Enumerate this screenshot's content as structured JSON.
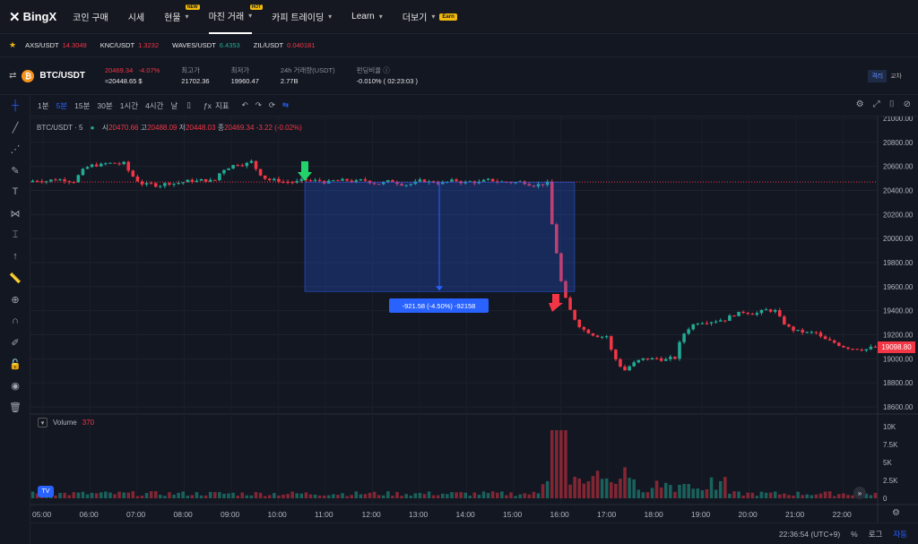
{
  "nav": {
    "brand": "BingX",
    "items": [
      {
        "label": "코인 구매"
      },
      {
        "label": "시세"
      },
      {
        "label": "현물",
        "badge": "NEW",
        "chevron": true
      },
      {
        "label": "마진 거래",
        "badge": "HOT",
        "chevron": true,
        "active": true
      },
      {
        "label": "카피 트레이딩",
        "chevron": true
      },
      {
        "label": "Learn",
        "chevron": true
      },
      {
        "label": "더보기",
        "chevron": true,
        "earn": "Earn"
      }
    ]
  },
  "ticker": [
    {
      "pair": "AXS/USDT",
      "price": "14.3049",
      "dir": "down"
    },
    {
      "pair": "KNC/USDT",
      "price": "1.3232",
      "dir": "down"
    },
    {
      "pair": "WAVES/USDT",
      "price": "6.4353",
      "dir": "up"
    },
    {
      "pair": "ZIL/USDT",
      "price": "0.040181",
      "dir": "down"
    }
  ],
  "pair": {
    "symbol": "BTC/USDT",
    "last_price": "20469.34",
    "change": "-4.07%",
    "usd": "≈20448.65 $",
    "high_label": "최고가",
    "high": "21702.36",
    "low_label": "최저가",
    "low": "19960.47",
    "vol_label": "24h 거래량(USDT)",
    "vol": "2.77B",
    "funding_label": "펀딩비율 ⓘ",
    "funding": "-0.010%  ( 02:23:03 )",
    "mode_a": "격리",
    "mode_b": "교차"
  },
  "toolbar": {
    "intervals": [
      "1분",
      "5분",
      "15분",
      "30분",
      "1시간",
      "4시간",
      "날"
    ],
    "active_interval": "5분",
    "indicators": "지표"
  },
  "legend": {
    "symbol": "BTC/USDT · 5",
    "open_label": "시",
    "open": "20470.66",
    "high_label": "고",
    "high": "20488.09",
    "low_label": "저",
    "low": "20448.03",
    "close_label": "종",
    "close": "20469.34",
    "change": "-3.22 (-0.02%)"
  },
  "volume": {
    "label": "Volume",
    "value": "370"
  },
  "measure": {
    "text": "-921.58 (-4.50%) -92158"
  },
  "last_price_tag": "19098.80",
  "price_axis": [
    "21000.00",
    "20800.00",
    "20600.00",
    "20400.00",
    "20200.00",
    "20000.00",
    "19800.00",
    "19600.00",
    "19400.00",
    "19200.00",
    "19000.00",
    "18800.00",
    "18600.00"
  ],
  "volume_axis": [
    "10K",
    "7.5K",
    "5K",
    "2.5K",
    "0"
  ],
  "time_axis": [
    "05:00",
    "06:00",
    "07:00",
    "08:00",
    "09:00",
    "10:00",
    "11:00",
    "12:00",
    "13:00",
    "14:00",
    "15:00",
    "16:00",
    "17:00",
    "18:00",
    "19:00",
    "20:00",
    "21:00",
    "22:00"
  ],
  "clock": "22:36:54 (UTC+9)",
  "bottom": {
    "pct": "%",
    "log": "로그",
    "auto": "자동"
  },
  "colors": {
    "up": "#22ab94",
    "down": "#f23645",
    "accent": "#2962ff"
  }
}
